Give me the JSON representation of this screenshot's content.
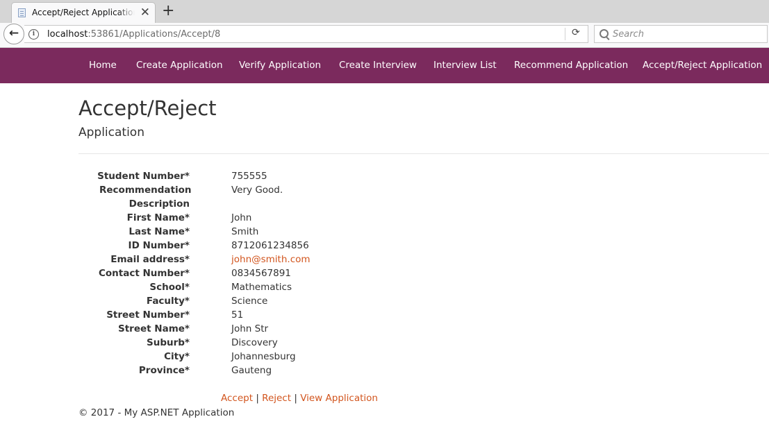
{
  "browser": {
    "tab_title": "Accept/Reject Application - My ASP.NET Application",
    "url_host": "localhost",
    "url_rest": ":53861/Applications/Accept/8",
    "search_placeholder": "Search",
    "close_glyph": "✕",
    "new_tab_glyph": "+",
    "back_glyph": "←",
    "reload_glyph": "⟳",
    "info_glyph": "i"
  },
  "nav": {
    "items": [
      {
        "label": "Home"
      },
      {
        "label": "Create Application"
      },
      {
        "label": "Verify Application"
      },
      {
        "label": "Create Interview"
      },
      {
        "label": "Interview List"
      },
      {
        "label": "Recommend Application"
      },
      {
        "label": "Accept/Reject Application"
      }
    ]
  },
  "page": {
    "title": "Accept/Reject",
    "subtitle": "Application"
  },
  "details": [
    {
      "label": "Student Number*",
      "value": "755555"
    },
    {
      "label": "Recommendation Description",
      "value": "Very Good."
    },
    {
      "label": "First Name*",
      "value": "John"
    },
    {
      "label": "Last Name*",
      "value": "Smith"
    },
    {
      "label": "ID Number*",
      "value": "8712061234856"
    },
    {
      "label": "Email address*",
      "value": "john@smith.com"
    },
    {
      "label": "Contact Number*",
      "value": "0834567891"
    },
    {
      "label": "School*",
      "value": "Mathematics"
    },
    {
      "label": "Faculty*",
      "value": "Science"
    },
    {
      "label": "Street Number*",
      "value": "51"
    },
    {
      "label": "Street Name*",
      "value": "John Str"
    },
    {
      "label": "Suburb*",
      "value": "Discovery"
    },
    {
      "label": "City*",
      "value": "Johannesburg"
    },
    {
      "label": "Province*",
      "value": "Gauteng"
    }
  ],
  "actions": {
    "accept": "Accept",
    "reject": "Reject",
    "view": "View Application",
    "separator": "|"
  },
  "footer": {
    "text": "© 2017 - My ASP.NET Application"
  },
  "colors": {
    "navbar": "#7b2a5d",
    "link": "#d2551e"
  }
}
